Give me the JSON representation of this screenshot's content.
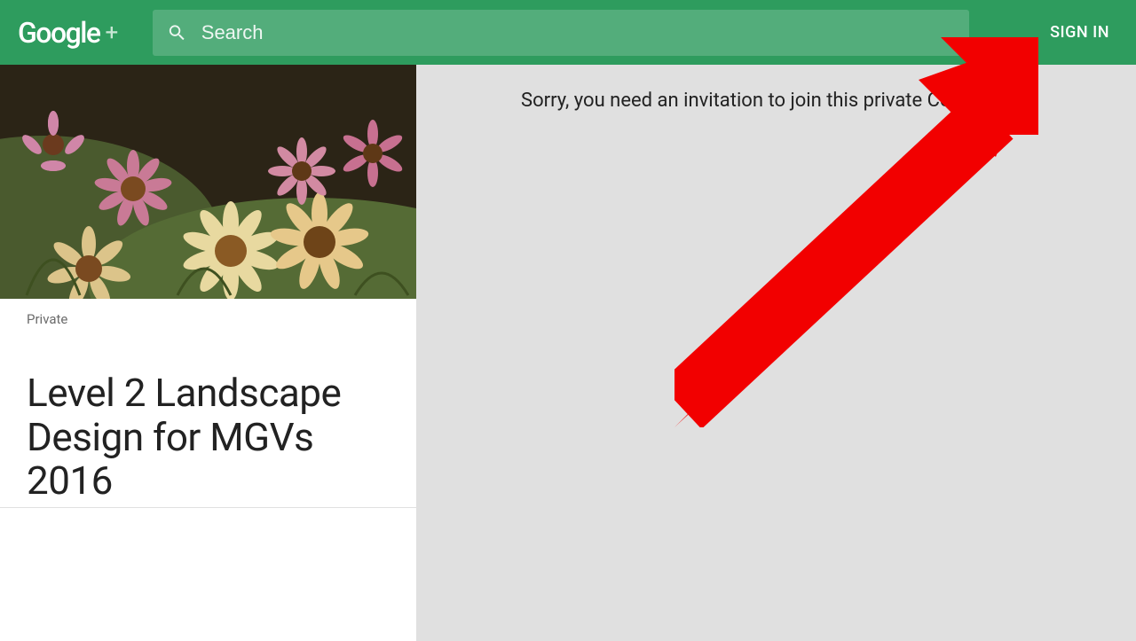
{
  "header": {
    "logo_text": "Google",
    "logo_plus": "+",
    "search_placeholder": "Search",
    "signin_label": "SIGN IN"
  },
  "sidebar": {
    "privacy_label": "Private",
    "community_title": "Level 2 Landscape Design for MGVs 2016"
  },
  "main": {
    "message": "Sorry, you need an invitation to join this private Community."
  },
  "colors": {
    "brand_green": "#2e9c5e",
    "arrow_red": "#f20000"
  }
}
